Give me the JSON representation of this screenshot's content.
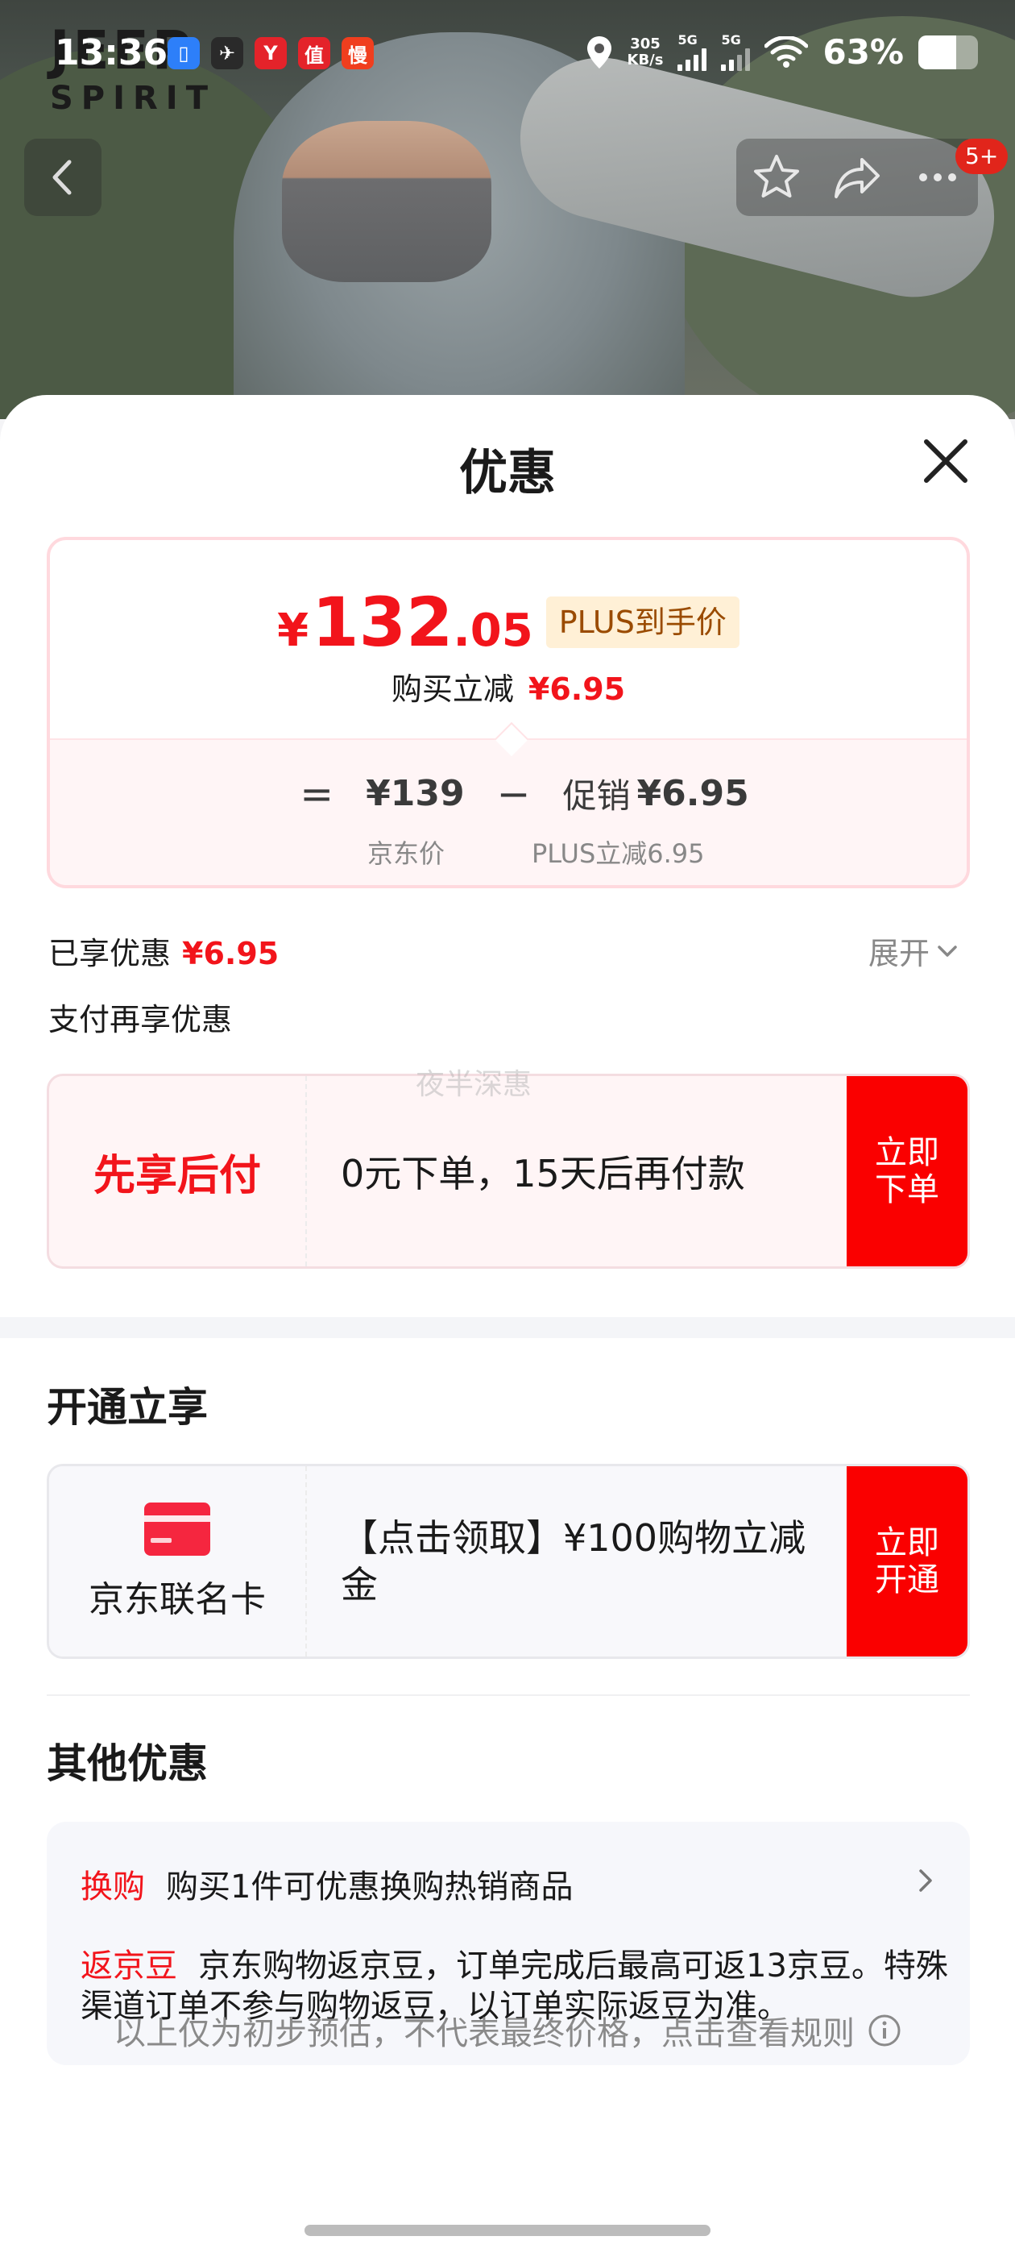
{
  "status_bar": {
    "time": "13:36",
    "net_speed_value": "305",
    "net_speed_unit": "KB/s",
    "sim1": "5G",
    "sim2": "5G",
    "battery_pct": "63%",
    "battery_level": 0.63,
    "app_icons": [
      {
        "name": "app-icon-1",
        "glyph": "▯",
        "color": "#2d7ff9"
      },
      {
        "name": "app-icon-2",
        "glyph": "✈",
        "color": "#2a2a2a"
      },
      {
        "name": "app-icon-3",
        "glyph": "Y",
        "color": "#e4232a"
      },
      {
        "name": "app-icon-4",
        "glyph": "值",
        "color": "#e4232a"
      },
      {
        "name": "app-icon-5",
        "glyph": "慢",
        "color": "#f03e1e"
      }
    ]
  },
  "hero": {
    "brand_line1": "JEEP",
    "brand_line2": "SPIRIT",
    "badge": "5+"
  },
  "sheet": {
    "title": "优惠",
    "price": {
      "yen": "¥",
      "integer": "132",
      "decimal": ".05",
      "tag": "PLUS到手价",
      "reduce_label": "购买立减",
      "reduce_amount": "¥6.95",
      "eq": "=",
      "jd_price": "¥139",
      "minus": "−",
      "promo_label": "促销",
      "promo_amount": "¥6.95",
      "jd_price_label": "京东价",
      "promo_sub": "PLUS立减6.95"
    },
    "enjoyed_label": "已享优惠",
    "enjoyed_amount": "¥6.95",
    "expand_label": "展开",
    "pay_more_label": "支付再享优惠",
    "pay_offer": {
      "left": "先享后付",
      "desc": "0元下单，15天后再付款",
      "cta": "立即下单",
      "watermark": "夜半深惠"
    },
    "open_section_title": "开通立享",
    "card_offer": {
      "left": "京东联名卡",
      "desc": "【点击领取】¥100购物立减金",
      "cta": "立即开通"
    },
    "other_section_title": "其他优惠",
    "other": {
      "row1_tag": "换购",
      "row1_text": "购买1件可优惠换购热销商品",
      "row2_tag": "返京豆",
      "row2_text": "京东购物返京豆，订单完成后最高可返13京豆。特殊渠道订单不参与购物返豆，以订单实际返豆为准。"
    },
    "footer_note": "以上仅为初步预估，不代表最终价格，点击查看规则"
  },
  "colors": {
    "accent_red": "#f2141b",
    "cta_red": "#fa0000",
    "plus_tag_bg": "#fff0d6"
  }
}
